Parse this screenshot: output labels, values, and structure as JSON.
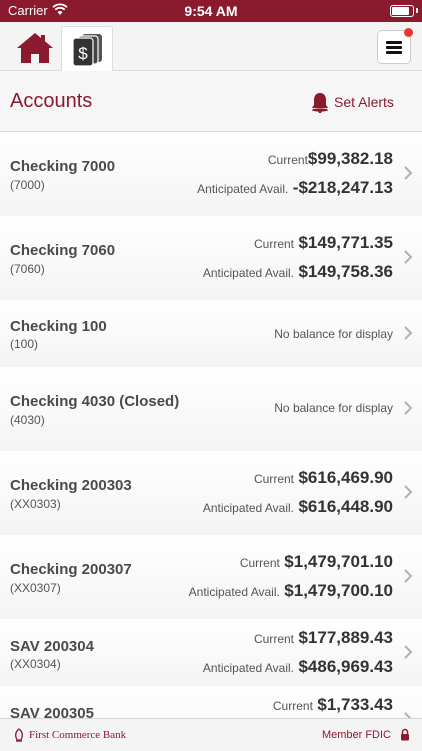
{
  "status_bar": {
    "carrier": "Carrier",
    "time": "9:54 AM"
  },
  "header": {
    "tabs": [
      {
        "icon": "home-icon"
      },
      {
        "icon": "accounts-dollar-icon"
      }
    ],
    "menu_icon": "hamburger-menu-icon"
  },
  "page": {
    "title": "Accounts",
    "set_alerts_label": "Set Alerts"
  },
  "accounts": [
    {
      "name": "Checking 7000",
      "number": "(7000)",
      "current_label": "Current",
      "current": "$99,382.18",
      "anticipated_label": "Anticipated Avail.",
      "anticipated": "-$218,247.13"
    },
    {
      "name": "Checking 7060",
      "number": "(7060)",
      "current_label": "Current",
      "current": "$149,771.35",
      "anticipated_label": "Anticipated Avail.",
      "anticipated": "$149,758.36"
    },
    {
      "name": "Checking 100",
      "number": "(100)",
      "no_balance": "No balance for display"
    },
    {
      "name": "Checking 4030 (Closed)",
      "number": "(4030)",
      "no_balance": "No balance for display"
    },
    {
      "name": "Checking 200303",
      "number": "(XX0303)",
      "current_label": "Current",
      "current": "$616,469.90",
      "anticipated_label": "Anticipated Avail.",
      "anticipated": "$616,448.90"
    },
    {
      "name": "Checking 200307",
      "number": "(XX0307)",
      "current_label": "Current",
      "current": "$1,479,701.10",
      "anticipated_label": "Anticipated Avail.",
      "anticipated": "$1,479,700.10"
    },
    {
      "name": "SAV 200304",
      "number": "(XX0304)",
      "current_label": "Current",
      "current": "$177,889.43",
      "anticipated_label": "Anticipated Avail.",
      "anticipated": "$486,969.43"
    },
    {
      "name": "SAV 200305",
      "number": "",
      "current_label": "Current",
      "current": "$1,733.43"
    }
  ],
  "footer": {
    "bank_name": "First Commerce Bank",
    "member_fdic": "Member FDIC"
  },
  "colors": {
    "brand": "#8b1a2e",
    "alert_dot": "#e53935"
  }
}
